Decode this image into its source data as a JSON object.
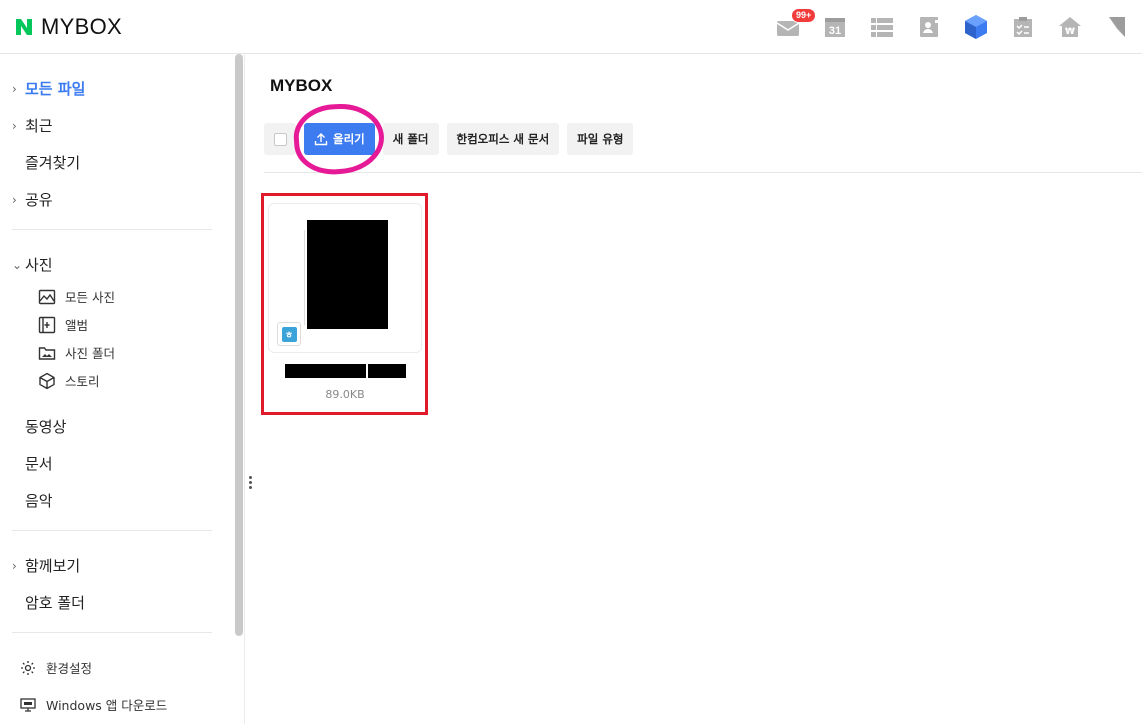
{
  "app": {
    "logo_letter": "N",
    "logo_text": "MYBOX",
    "brand_color": "#03c75a",
    "accent_color": "#3c7bf0"
  },
  "top_icons": [
    {
      "name": "mail-icon",
      "badge": "99+"
    },
    {
      "name": "calendar-icon",
      "label": "31"
    },
    {
      "name": "list-icon"
    },
    {
      "name": "contacts-icon"
    },
    {
      "name": "mybox-icon"
    },
    {
      "name": "todo-icon"
    },
    {
      "name": "home-pay-icon"
    },
    {
      "name": "bookmark-icon"
    }
  ],
  "sidebar": {
    "all_files": "모든 파일",
    "recent": "최근",
    "favorites": "즐겨찾기",
    "shared": "공유",
    "photos": "사진",
    "photo_items": [
      "모든 사진",
      "앨범",
      "사진 폴더",
      "스토리"
    ],
    "videos": "동영상",
    "documents": "문서",
    "music": "음악",
    "together": "함께보기",
    "secret_folder": "암호 폴더",
    "settings": "환경설정",
    "windows_download": "Windows 앱 다운로드"
  },
  "main": {
    "title": "MYBOX",
    "toolbar": {
      "upload": "올리기",
      "new_folder": "새 폴더",
      "hancom_new_doc": "한컴오피스 새 문서",
      "file_type": "파일 유형"
    },
    "files": [
      {
        "type_badge": "ㅎ",
        "size": "89.0KB"
      }
    ]
  },
  "annotations": {
    "circle_color": "#e61a96",
    "box_color": "#e01a2b"
  }
}
